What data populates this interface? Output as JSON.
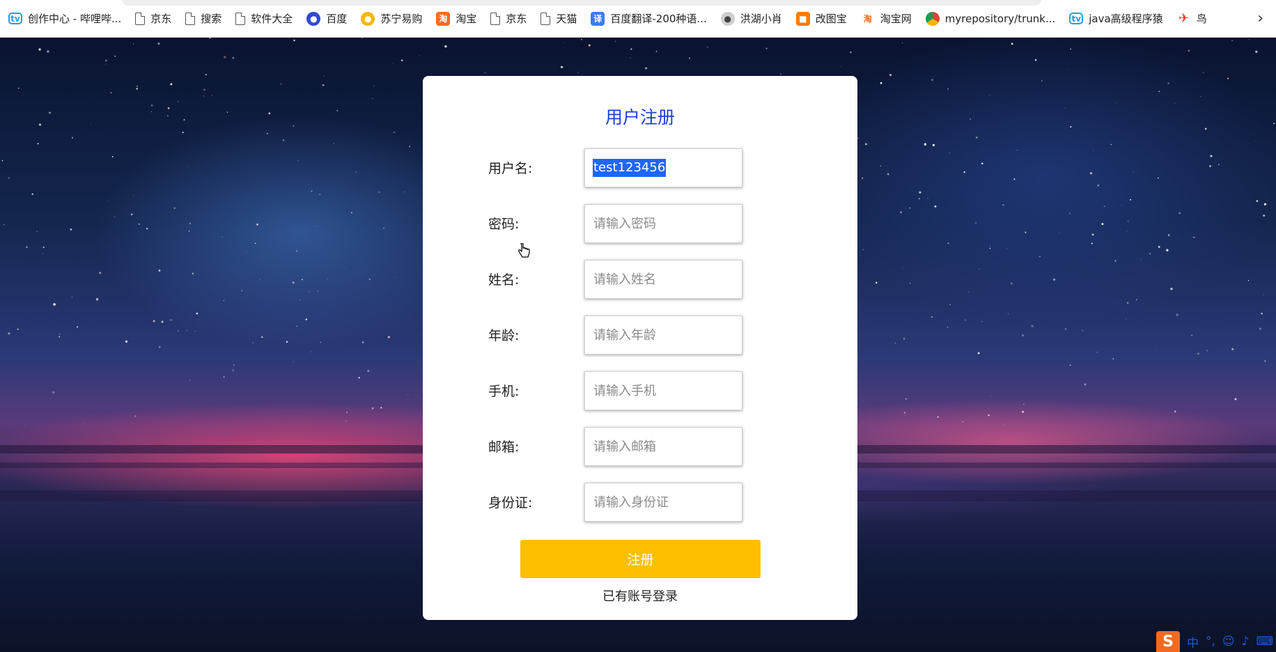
{
  "bookmarks": [
    {
      "icon": "bilibili-icon",
      "label": "创作中心 - 哔哩哔..."
    },
    {
      "icon": "page-icon",
      "label": "京东"
    },
    {
      "icon": "page-icon",
      "label": "搜索"
    },
    {
      "icon": "page-icon",
      "label": "软件大全"
    },
    {
      "icon": "baidu-paw-icon",
      "label": "百度"
    },
    {
      "icon": "suning-icon",
      "label": "苏宁易购"
    },
    {
      "icon": "taobao-icon",
      "label": "淘宝"
    },
    {
      "icon": "page-icon",
      "label": "京东"
    },
    {
      "icon": "page-icon",
      "label": "天猫"
    },
    {
      "icon": "translate-icon",
      "label": "百度翻译-200种语..."
    },
    {
      "icon": "bird-icon",
      "label": "洪湖小肖"
    },
    {
      "icon": "gaitubao-icon",
      "label": "改图宝"
    },
    {
      "icon": "taobao-icon",
      "label": "淘宝网"
    },
    {
      "icon": "chrome-icon",
      "label": "myrepository/trunk..."
    },
    {
      "icon": "bilibili-icon",
      "label": "java高级程序猿"
    },
    {
      "icon": "niao-icon",
      "label": "鸟"
    }
  ],
  "form": {
    "title": "用户注册",
    "fields": [
      {
        "label": "用户名:",
        "value": "test123456",
        "placeholder": ""
      },
      {
        "label": "密码:",
        "value": "",
        "placeholder": "请输入密码"
      },
      {
        "label": "姓名:",
        "value": "",
        "placeholder": "请输入姓名"
      },
      {
        "label": "年龄:",
        "value": "",
        "placeholder": "请输入年龄"
      },
      {
        "label": "手机:",
        "value": "",
        "placeholder": "请输入手机"
      },
      {
        "label": "邮箱:",
        "value": "",
        "placeholder": "请输入邮箱"
      },
      {
        "label": "身份证:",
        "value": "",
        "placeholder": "请输入身份证"
      }
    ],
    "submit_label": "注册",
    "login_link": "已有账号登录"
  },
  "tray": {
    "ime_label": "中",
    "icons": [
      "sogou-icon",
      "punctuation-icon",
      "emoji-icon",
      "mic-icon",
      "keyboard-icon"
    ]
  },
  "colors": {
    "title": "#1a3fcf",
    "button": "#ffbf00",
    "selection": "#1e66ff"
  }
}
